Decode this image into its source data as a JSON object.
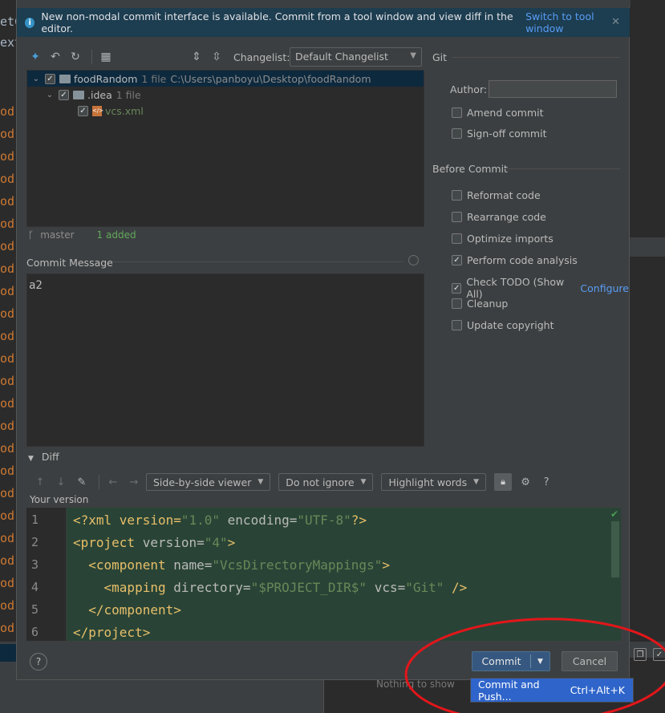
{
  "background_editor": {
    "lines": [
      "etC",
      "ext",
      "od",
      "od",
      "od",
      "od",
      "od",
      "od",
      "od",
      "od",
      "od",
      "od",
      "od",
      "od",
      "od",
      "od",
      "od",
      "od",
      "od",
      "od",
      "od",
      "od",
      "od",
      "od",
      "od",
      "od"
    ],
    "nothing_to_show": "Nothing to show"
  },
  "banner": {
    "text": "New non-modal commit interface is available. Commit from a tool window and view diff in the editor.",
    "link": "Switch to tool window",
    "close": "✕"
  },
  "toolbar": {
    "changelist_label": "Changelist:",
    "changelist_value": "Default Changelist"
  },
  "tree": {
    "root": {
      "name": "foodRandom",
      "meta": "1 file",
      "path": "C:\\Users\\panboyu\\Desktop\\foodRandom"
    },
    "folder": {
      "name": ".idea",
      "meta": "1 file"
    },
    "file": {
      "name": "vcs.xml"
    }
  },
  "branch": {
    "name": "master",
    "status": "1 added"
  },
  "commit_message": {
    "label": "Commit Message",
    "value": "a2"
  },
  "git": {
    "title": "Git",
    "author_label": "Author:",
    "author_value": "",
    "amend": "Amend commit",
    "signoff": "Sign-off commit"
  },
  "before_commit": {
    "title": "Before Commit",
    "options": [
      {
        "label": "Reformat code",
        "checked": false
      },
      {
        "label": "Rearrange code",
        "checked": false
      },
      {
        "label": "Optimize imports",
        "checked": false
      },
      {
        "label": "Perform code analysis",
        "checked": true
      },
      {
        "label": "Check TODO (Show All)",
        "checked": true,
        "link": "Configure"
      },
      {
        "label": "Cleanup",
        "checked": false
      },
      {
        "label": "Update copyright",
        "checked": false
      }
    ]
  },
  "diff": {
    "title": "Diff",
    "viewer": "Side-by-side viewer",
    "ignore": "Do not ignore",
    "highlight": "Highlight words",
    "help": "?",
    "your_version": "Your version",
    "line_numbers": [
      "1",
      "2",
      "3",
      "4",
      "5",
      "6"
    ]
  },
  "code": {
    "l1": {
      "a": "<?xml version=",
      "b": "\"1.0\"",
      "c": " encoding=",
      "d": "\"UTF-8\"",
      "e": "?>"
    },
    "l2": {
      "a": "<project ",
      "b": "version=",
      "c": "\"4\"",
      "d": ">"
    },
    "l3": {
      "a": "  <component ",
      "b": "name=",
      "c": "\"VcsDirectoryMappings\"",
      "d": ">"
    },
    "l4": {
      "a": "    <mapping ",
      "b": "directory=",
      "c": "\"$PROJECT_DIR$\"",
      "d": " vcs=",
      "e": "\"Git\"",
      "f": " />"
    },
    "l5": {
      "a": "  </component>"
    },
    "l6": {
      "a": "</project>"
    }
  },
  "buttons": {
    "help": "?",
    "commit": "Commit",
    "cancel": "Cancel"
  },
  "popup": {
    "label": "Commit and Push...",
    "shortcut": "Ctrl+Alt+K"
  },
  "colors": {
    "annotation_circle": "#e3161a",
    "commit_button": "#365880",
    "popup": "#2f65ca",
    "diff_added_bg": "#294436"
  }
}
